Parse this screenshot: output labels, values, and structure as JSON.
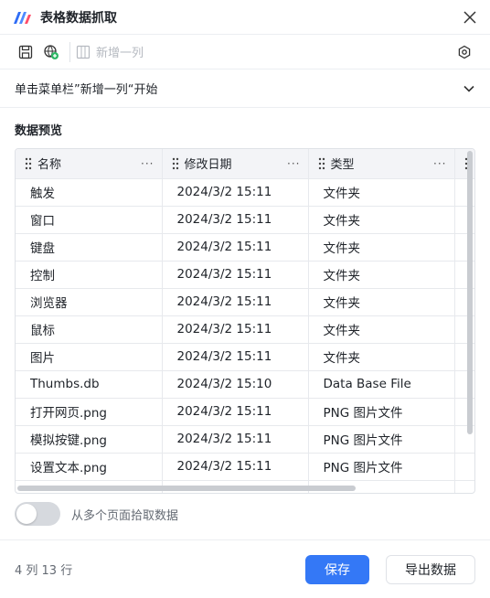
{
  "window": {
    "title": "表格数据抓取"
  },
  "toolbar": {
    "add_column_label": "新增一列"
  },
  "hint": {
    "text": "单击菜单栏”新增一列“开始"
  },
  "preview": {
    "section_title": "数据预览",
    "columns": [
      "名称",
      "修改日期",
      "类型"
    ],
    "rows": [
      [
        "触发",
        "2024/3/2 15:11",
        "文件夹"
      ],
      [
        "窗口",
        "2024/3/2 15:11",
        "文件夹"
      ],
      [
        "键盘",
        "2024/3/2 15:11",
        "文件夹"
      ],
      [
        "控制",
        "2024/3/2 15:11",
        "文件夹"
      ],
      [
        "浏览器",
        "2024/3/2 15:11",
        "文件夹"
      ],
      [
        "鼠标",
        "2024/3/2 15:11",
        "文件夹"
      ],
      [
        "图片",
        "2024/3/2 15:11",
        "文件夹"
      ],
      [
        "Thumbs.db",
        "2024/3/2 15:10",
        "Data Base File"
      ],
      [
        "打开网页.png",
        "2024/3/2 15:11",
        "PNG 图片文件"
      ],
      [
        "模拟按键.png",
        "2024/3/2 15:11",
        "PNG 图片文件"
      ],
      [
        "设置文本.png",
        "2024/3/2 15:11",
        "PNG 图片文件"
      ],
      [
        "",
        "",
        ""
      ]
    ]
  },
  "options": {
    "multi_page_label": "从多个页面拾取数据",
    "multi_page_enabled": false
  },
  "footer": {
    "count_text": "4 列 13 行",
    "save_label": "保存",
    "export_label": "导出数据"
  },
  "colors": {
    "accent": "#3478f6",
    "header_bg": "#f3f4f7",
    "muted": "#646a73"
  },
  "icons": [
    "app-logo-icon",
    "close-icon",
    "save-icon",
    "add-web-icon",
    "add-column-icon",
    "settings-icon",
    "chevron-down-icon",
    "drag-handle-icon",
    "more-icon"
  ]
}
